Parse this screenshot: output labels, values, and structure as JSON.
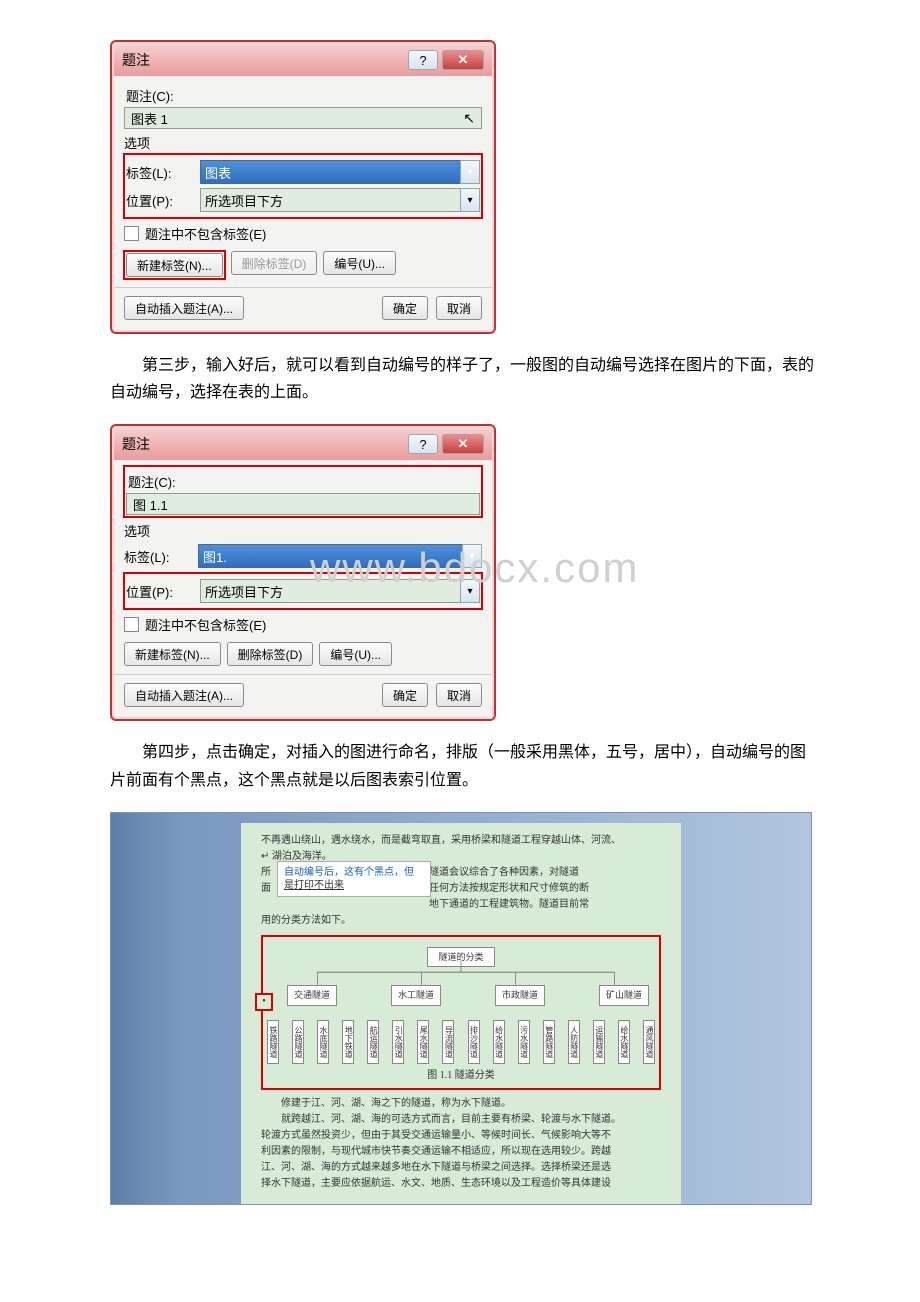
{
  "dialog1": {
    "title": "题注",
    "caption_label": "题注(C):",
    "caption_value": "图表 1",
    "options_label": "选项",
    "label_lbl": "标签(L):",
    "label_value": "图表",
    "position_lbl": "位置(P):",
    "position_value": "所选项目下方",
    "exclude_chk": "题注中不包含标签(E)",
    "new_label_btn": "新建标签(N)...",
    "delete_label_btn": "删除标签(D)",
    "numbering_btn": "编号(U)...",
    "auto_caption_btn": "自动插入题注(A)...",
    "ok_btn": "确定",
    "cancel_btn": "取消"
  },
  "para1": "第三步，输入好后，就可以看到自动编号的样子了，一般图的自动编号选择在图片的下面，表的自动编号，选择在表的上面。",
  "dialog2": {
    "title": "题注",
    "caption_label": "题注(C):",
    "caption_value": "图 1.1",
    "options_label": "选项",
    "label_lbl": "标签(L):",
    "label_value": "图1.",
    "position_lbl": "位置(P):",
    "position_value": "所选项目下方",
    "exclude_chk": "题注中不包含标签(E)",
    "new_label_btn": "新建标签(N)...",
    "delete_label_btn": "删除标签(D)",
    "numbering_btn": "编号(U)...",
    "auto_caption_btn": "自动插入题注(A)...",
    "ok_btn": "确定",
    "cancel_btn": "取消"
  },
  "watermark": "www.bdocx.com",
  "para2": "第四步，点击确定，对插入的图进行命名，排版（一般采用黑体，五号，居中），自动编号的图片前面有个黑点，这个黑点就是以后图表索引位置。",
  "example": {
    "line1": "不再遇山绕山，遇水绕水，而是截弯取直，采用桥梁和隧道工程穿越山体、河流、",
    "line2": "湖泊及海洋。",
    "callout_l1": "自动编号后，这有个黑点，但",
    "callout_l2": "是打印不出来",
    "partial_r1": "隧道会议综合了各种因素，对隧道",
    "partial_r2": "任何方法按规定形状和尺寸修筑的断",
    "partial_r3": "地下通道的工程建筑物。隧道目前常",
    "partial_l1": "所",
    "partial_l2": "面",
    "line_cut": "用的分类方法如下。",
    "chart_title": "隧道的分类",
    "lvl2": [
      "交通隧道",
      "水工隧道",
      "市政隧道",
      "矿山隧道"
    ],
    "lvl3": [
      "铁路隧道",
      "公路隧道",
      "水底隧道",
      "地下铁道",
      "航运隧道",
      "引水隧道",
      "尾水隧道",
      "导流隧道",
      "排沙隧道",
      "给水隧道",
      "污水隧道",
      "管路隧道",
      "人防隧道",
      "运输隧道",
      "给水隧道",
      "通风隧道"
    ],
    "caption": "图 1.1  隧道分类",
    "p2": "修建于江、河、湖、海之下的隧道，称为水下隧道。",
    "p3": "就跨越江、河、湖、海的可选方式而言，目前主要有桥梁、轮渡与水下隧道。",
    "p4": "轮渡方式虽然投资少，但由于其受交通运输量小、等候时间长、气候影响大等不",
    "p5": "利因素的限制，与现代城市快节奏交通运输不相适应，所以现在选用较少。跨越",
    "p6": "江、河、湖、海的方式越来越多地在水下隧道与桥梁之间选择。选择桥梁还是选",
    "p7": "择水下隧道，主要应依据航运、水文、地质、生态环境以及工程造价等具体建设"
  }
}
